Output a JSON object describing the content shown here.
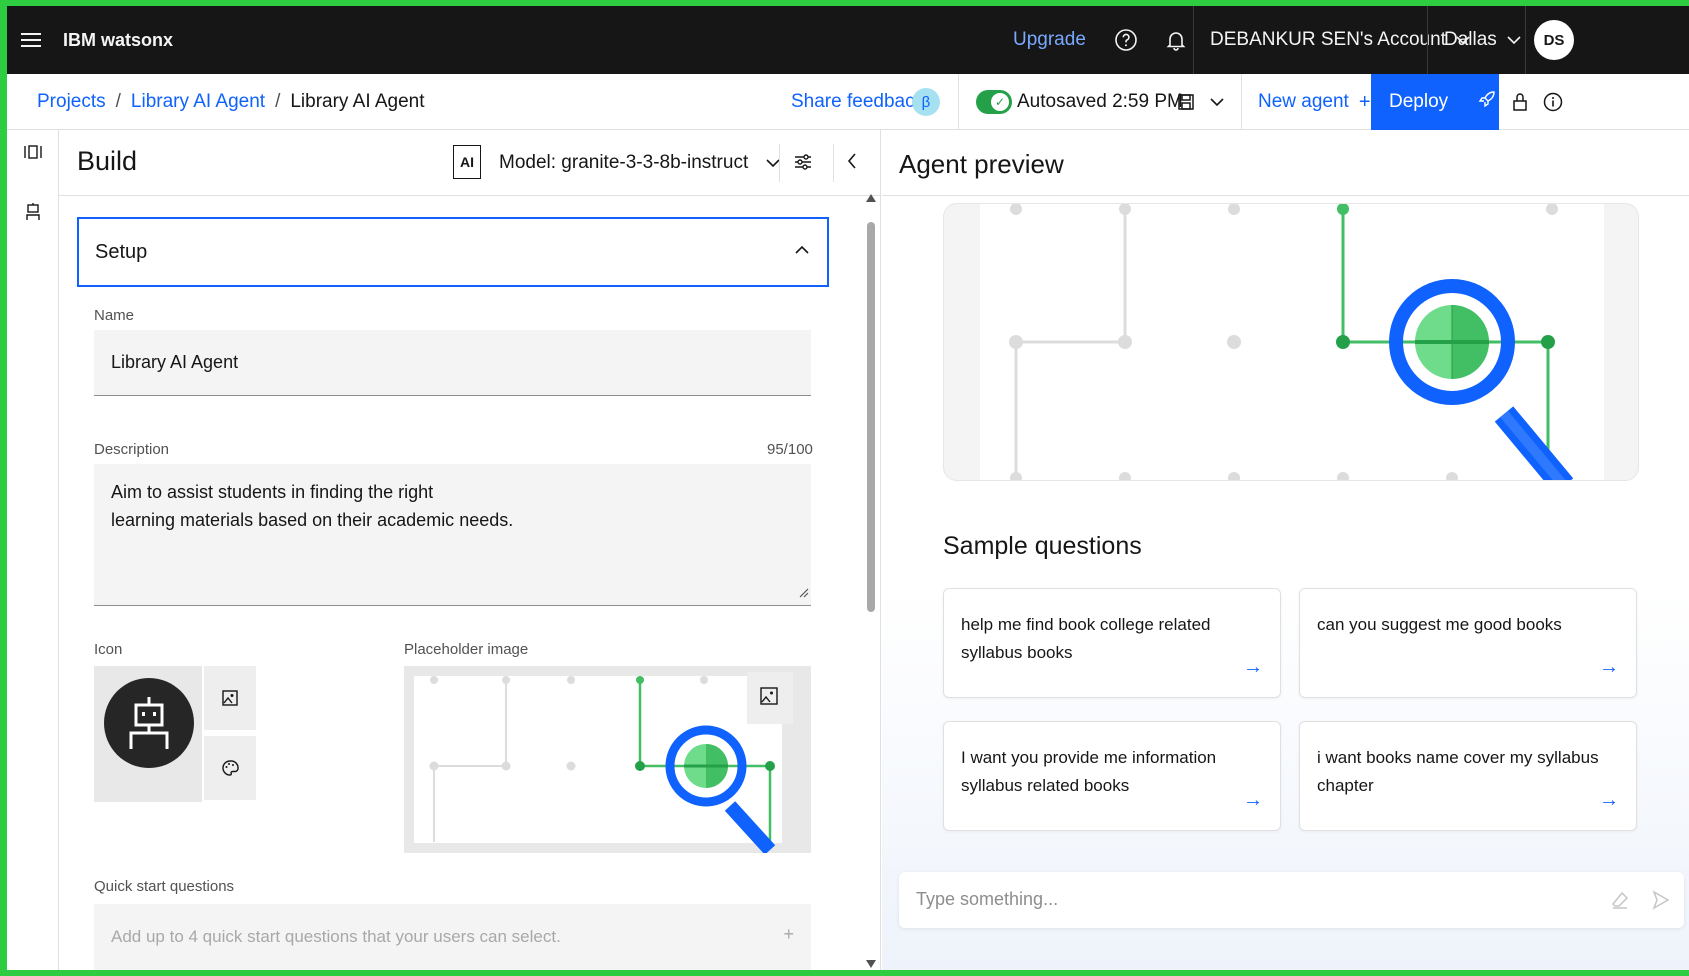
{
  "topbar": {
    "brand": "IBM watsonx",
    "upgrade": "Upgrade",
    "account": "DEBANKUR SEN's Account",
    "region": "Dallas",
    "avatar_initials": "DS"
  },
  "breadcrumb": {
    "items": [
      "Projects",
      "Library AI Agent",
      "Library AI Agent"
    ],
    "separator": "/"
  },
  "toolbar": {
    "share_feedback": "Share feedback",
    "beta": "β",
    "autosaved": "Autosaved 2:59 PM",
    "new_agent": "New agent",
    "deploy": "Deploy"
  },
  "build": {
    "title": "Build",
    "ai_badge": "AI",
    "model_label": "Model: granite-3-3-8b-instruct",
    "setup_label": "Setup",
    "name_label": "Name",
    "name_value": "Library AI Agent",
    "description_label": "Description",
    "description_count": "95/100",
    "description_value": "Aim to assist students in finding the right\nlearning materials based on their academic needs.",
    "icon_label": "Icon",
    "placeholder_image_label": "Placeholder image",
    "quick_start_label": "Quick start questions",
    "quick_start_placeholder": "Add up to 4 quick start questions that your users can select."
  },
  "preview": {
    "title": "Agent preview",
    "sample_title": "Sample questions",
    "questions": [
      "help me find book college related syllabus books",
      "can you suggest me good books",
      "I want you provide me information syllabus related books",
      "i want books name cover my syllabus chapter"
    ],
    "chat_placeholder": "Type something..."
  },
  "colors": {
    "accent": "#0f62fe",
    "topbar_bg": "#161616",
    "toggle_on": "#24a148",
    "magnifier_green": "#42be65"
  },
  "icons": [
    "menu-icon",
    "help-icon",
    "notification-icon",
    "chevron-down-icon",
    "save-icon",
    "rocket-icon",
    "lock-icon",
    "info-icon",
    "settings-adjust-icon",
    "chevron-left-icon",
    "robot-icon",
    "image-icon",
    "palette-icon",
    "arrow-right-icon",
    "eraser-icon",
    "send-icon"
  ]
}
